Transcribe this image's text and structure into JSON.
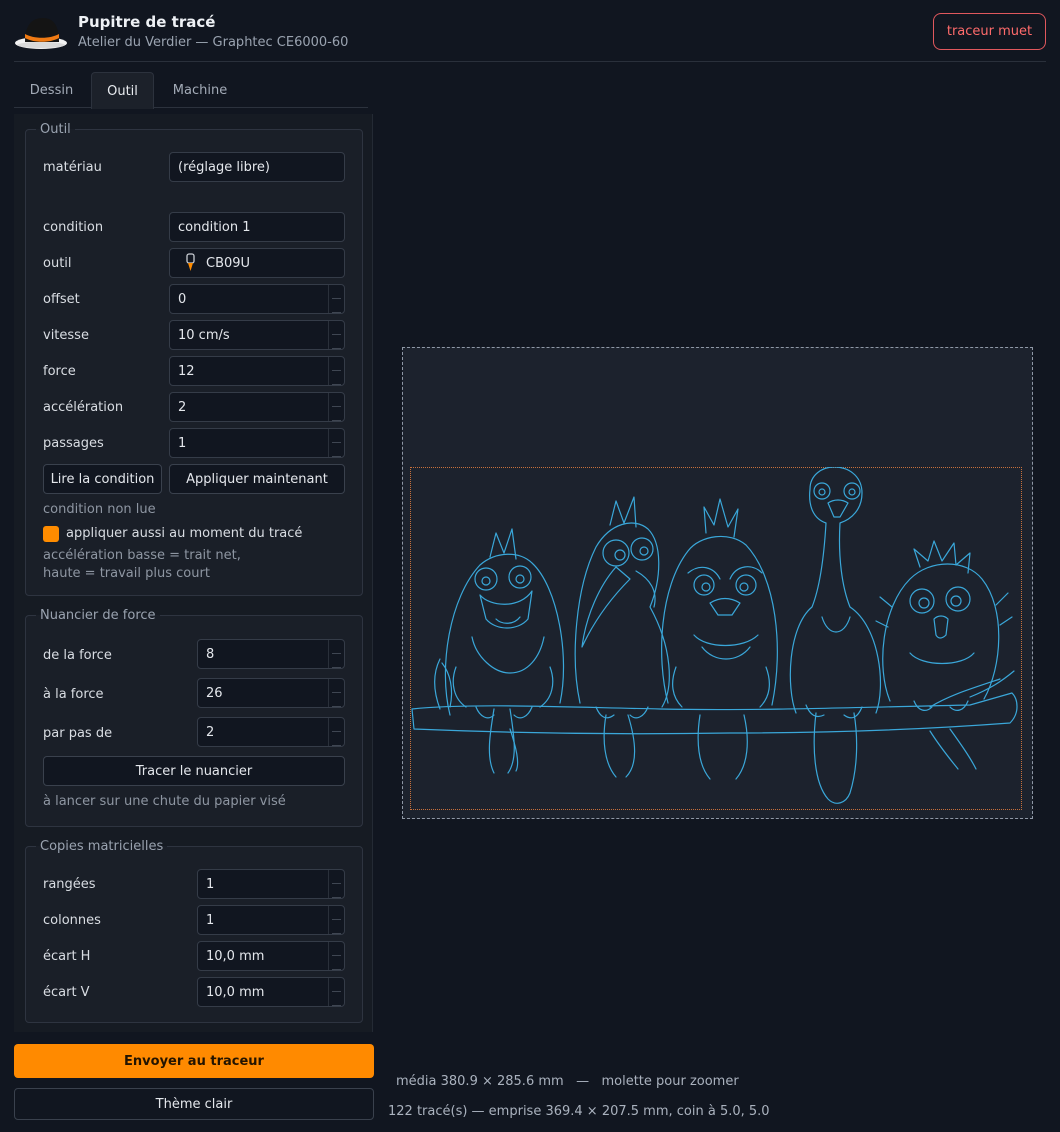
{
  "header": {
    "title": "Pupitre de tracé",
    "subtitle": "Atelier du Verdier — Graphtec CE6000-60",
    "status_button": "traceur muet",
    "logo_icon": "hat-icon"
  },
  "tabs": [
    {
      "label": "Dessin",
      "active": false
    },
    {
      "label": "Outil",
      "active": true
    },
    {
      "label": "Machine",
      "active": false
    }
  ],
  "outil": {
    "legend": "Outil",
    "materiau_label": "matériau",
    "materiau_value": "(réglage libre)",
    "condition_label": "condition",
    "condition_value": "condition 1",
    "outil_label": "outil",
    "outil_value": "CB09U",
    "outil_icon": "blade-icon",
    "offset_label": "offset",
    "offset_value": "0",
    "vitesse_label": "vitesse",
    "vitesse_value": "10 cm/s",
    "force_label": "force",
    "force_value": "12",
    "acceleration_label": "accélération",
    "acceleration_value": "2",
    "passages_label": "passages",
    "passages_value": "1",
    "read_button": "Lire la condition",
    "apply_button": "Appliquer maintenant",
    "condition_status": "condition non lue",
    "apply_at_plot_label": "appliquer aussi au moment du tracé",
    "apply_at_plot_checked": true,
    "hint_line1": "accélération basse = trait net,",
    "hint_line2": "haute = travail plus court"
  },
  "nuancier": {
    "legend": "Nuancier de force",
    "from_label": "de la force",
    "from_value": "8",
    "to_label": "à la force",
    "to_value": "26",
    "step_label": "par pas de",
    "step_value": "2",
    "button": "Tracer le nuancier",
    "note": "à lancer sur une chute du papier visé"
  },
  "copies": {
    "legend": "Copies matricielles",
    "rows_label": "rangées",
    "rows_value": "1",
    "cols_label": "colonnes",
    "cols_value": "1",
    "gap_h_label": "écart H",
    "gap_h_value": "10,0 mm",
    "gap_v_label": "écart V",
    "gap_v_value": "10,0 mm"
  },
  "actions": {
    "send": "Envoyer au traceur",
    "theme": "Thème clair"
  },
  "status": {
    "line1": "média 380.9 × 285.6 mm   —   molette pour zoomer",
    "line2": "122 tracé(s) — emprise 369.4 × 207.5 mm, coin à 5.0, 5.0"
  },
  "colors": {
    "accent": "#ff8a00",
    "path_stroke": "#3aa7d9",
    "danger": "#ff6b6b"
  }
}
